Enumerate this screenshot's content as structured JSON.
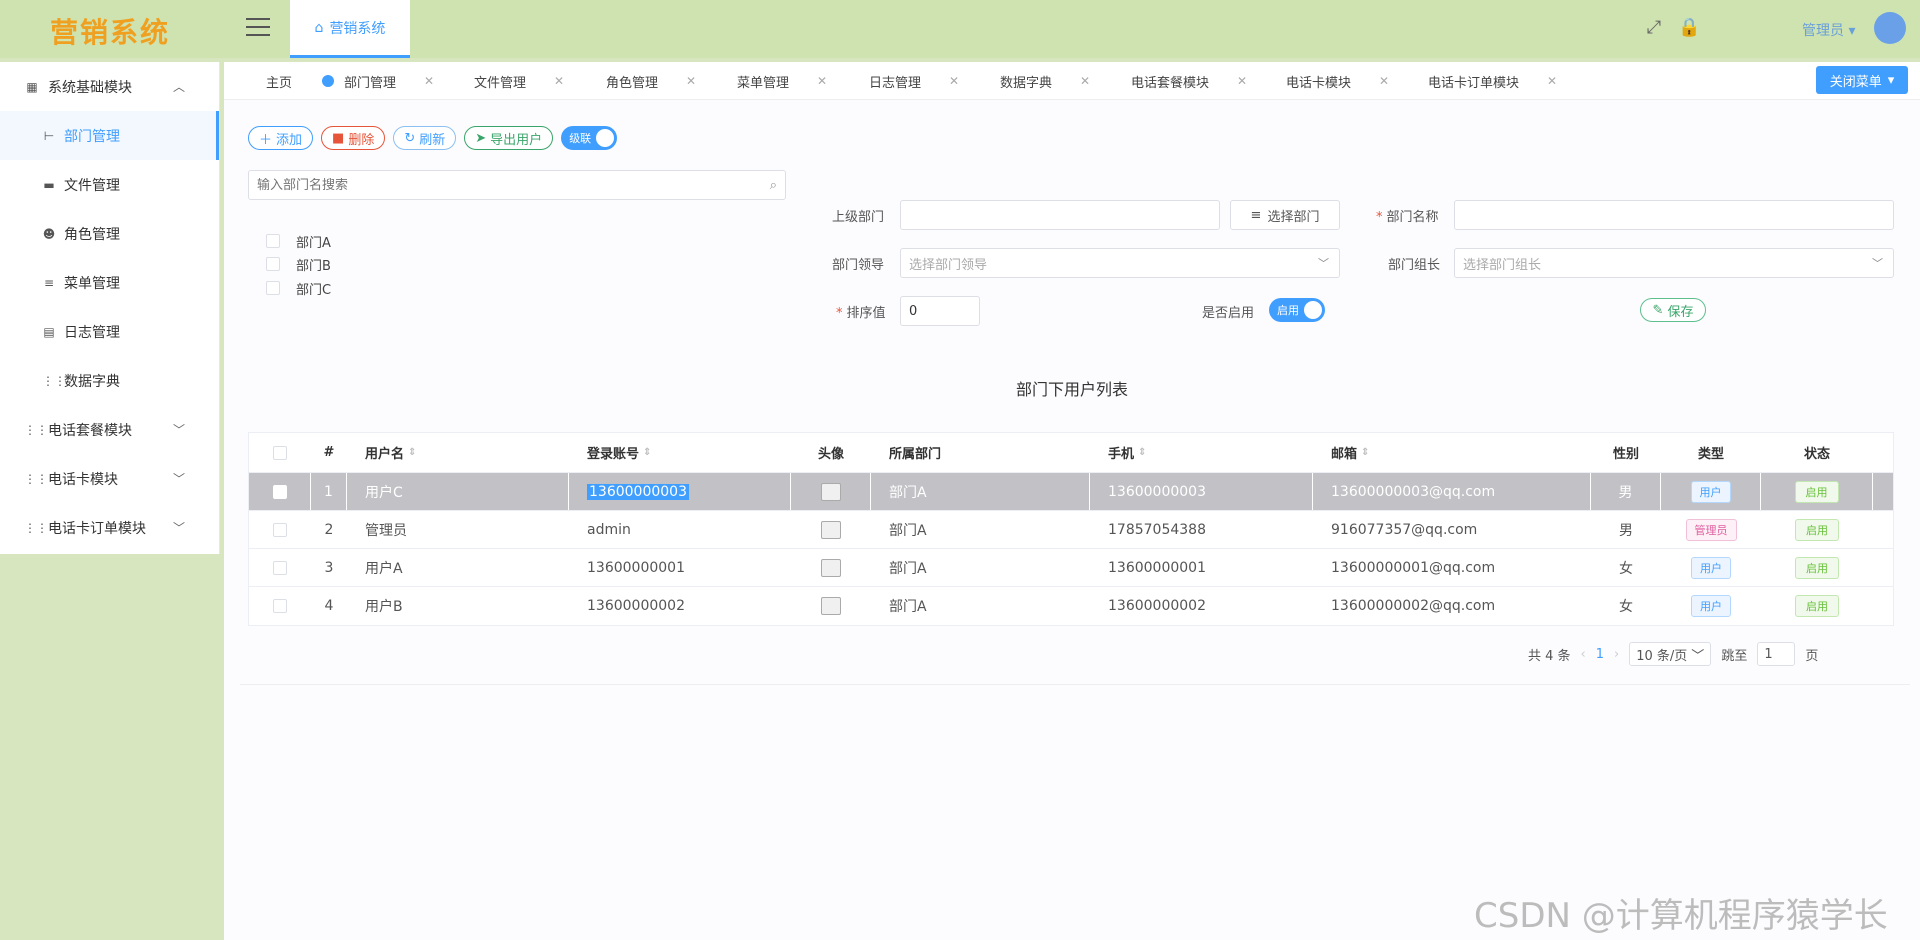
{
  "app": {
    "logo": "营销系统",
    "home_tab": "营销系统",
    "admin_name": "管理员"
  },
  "sidebar": {
    "groups": [
      {
        "label": "系统基础模块",
        "icon": "chart-icon",
        "expanded": true
      },
      {
        "label": "电话套餐模块",
        "icon": "grid-icon",
        "expanded": false
      },
      {
        "label": "电话卡模块",
        "icon": "grid-icon",
        "expanded": false
      },
      {
        "label": "电话卡订单模块",
        "icon": "grid-icon",
        "expanded": false
      }
    ],
    "items": [
      {
        "label": "部门管理",
        "icon": "dept-icon",
        "active": true
      },
      {
        "label": "文件管理",
        "icon": "folder-icon"
      },
      {
        "label": "角色管理",
        "icon": "users-icon"
      },
      {
        "label": "菜单管理",
        "icon": "list-icon"
      },
      {
        "label": "日志管理",
        "icon": "log-icon"
      },
      {
        "label": "数据字典",
        "icon": "grid-icon"
      }
    ]
  },
  "tabs": [
    "主页",
    "部门管理",
    "文件管理",
    "角色管理",
    "菜单管理",
    "日志管理",
    "数据字典",
    "电话套餐模块",
    "电话卡模块",
    "电话卡订单模块"
  ],
  "close_menu": "关闭菜单",
  "toolbar": {
    "add": "添加",
    "delete": "删除",
    "refresh": "刷新",
    "export": "导出用户",
    "cascade": "级联"
  },
  "tree": {
    "search_placeholder": "输入部门名搜索",
    "nodes": [
      "部门A",
      "部门B",
      "部门C"
    ]
  },
  "form": {
    "parent_label": "上级部门",
    "select_dept_btn": "选择部门",
    "name_label": "部门名称",
    "leader_label": "部门领导",
    "leader_placeholder": "选择部门领导",
    "head_label": "部门组长",
    "head_placeholder": "选择部门组长",
    "order_label": "排序值",
    "order_value": "0",
    "enabled_label": "是否启用",
    "enabled_toggle": "启用",
    "save": "保存"
  },
  "list_title": "部门下用户列表",
  "table": {
    "headers": [
      "#",
      "用户名",
      "登录账号",
      "头像",
      "所属部门",
      "手机",
      "邮箱",
      "性别",
      "类型",
      "状态"
    ],
    "rows": [
      {
        "idx": "1",
        "name": "用户C",
        "account": "13600000003",
        "dept": "部门A",
        "phone": "13600000003",
        "email": "13600000003@qq.com",
        "gender": "男",
        "type": "用户",
        "status": "启用"
      },
      {
        "idx": "2",
        "name": "管理员",
        "account": "admin",
        "dept": "部门A",
        "phone": "17857054388",
        "email": "916077357@qq.com",
        "gender": "男",
        "type": "管理员",
        "status": "启用"
      },
      {
        "idx": "3",
        "name": "用户A",
        "account": "13600000001",
        "dept": "部门A",
        "phone": "13600000001",
        "email": "13600000001@qq.com",
        "gender": "女",
        "type": "用户",
        "status": "启用"
      },
      {
        "idx": "4",
        "name": "用户B",
        "account": "13600000002",
        "dept": "部门A",
        "phone": "13600000002",
        "email": "13600000002@qq.com",
        "gender": "女",
        "type": "用户",
        "status": "启用"
      }
    ]
  },
  "pager": {
    "total": "共 4 条",
    "page": "1",
    "size": "10 条/页",
    "jump_label": "跳至",
    "jump_value": "1",
    "page_unit": "页"
  },
  "watermark": "CSDN @计算机程序猿学长"
}
